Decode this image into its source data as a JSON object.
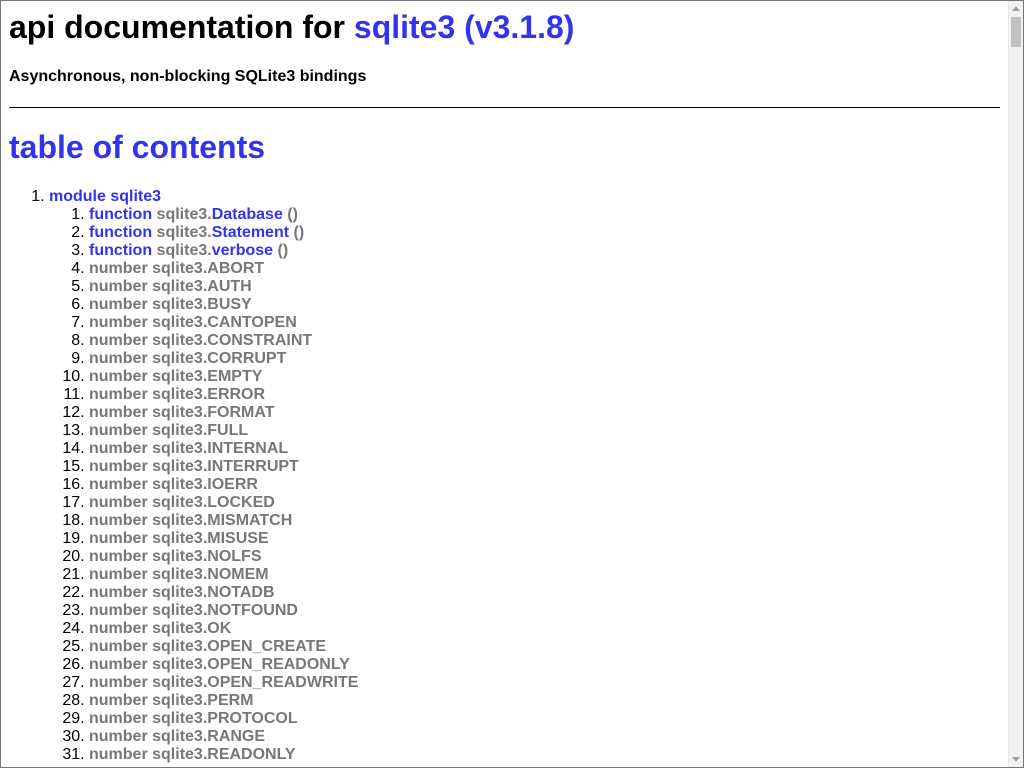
{
  "header": {
    "title_prefix": "api documentation for",
    "title_module": "sqlite3 (v3.1.8)",
    "subtitle": "Asynchronous, non-blocking SQLite3 bindings"
  },
  "toc": {
    "heading": "table of contents",
    "module": "module sqlite3",
    "items": [
      {
        "kind": "function",
        "ns": "sqlite3.",
        "name": "Database",
        "suffix": " ()"
      },
      {
        "kind": "function",
        "ns": "sqlite3.",
        "name": "Statement",
        "suffix": " ()"
      },
      {
        "kind": "function",
        "ns": "sqlite3.",
        "name": "verbose",
        "suffix": " ()"
      },
      {
        "kind": "number",
        "ns": "sqlite3.",
        "name": "ABORT",
        "suffix": ""
      },
      {
        "kind": "number",
        "ns": "sqlite3.",
        "name": "AUTH",
        "suffix": ""
      },
      {
        "kind": "number",
        "ns": "sqlite3.",
        "name": "BUSY",
        "suffix": ""
      },
      {
        "kind": "number",
        "ns": "sqlite3.",
        "name": "CANTOPEN",
        "suffix": ""
      },
      {
        "kind": "number",
        "ns": "sqlite3.",
        "name": "CONSTRAINT",
        "suffix": ""
      },
      {
        "kind": "number",
        "ns": "sqlite3.",
        "name": "CORRUPT",
        "suffix": ""
      },
      {
        "kind": "number",
        "ns": "sqlite3.",
        "name": "EMPTY",
        "suffix": ""
      },
      {
        "kind": "number",
        "ns": "sqlite3.",
        "name": "ERROR",
        "suffix": ""
      },
      {
        "kind": "number",
        "ns": "sqlite3.",
        "name": "FORMAT",
        "suffix": ""
      },
      {
        "kind": "number",
        "ns": "sqlite3.",
        "name": "FULL",
        "suffix": ""
      },
      {
        "kind": "number",
        "ns": "sqlite3.",
        "name": "INTERNAL",
        "suffix": ""
      },
      {
        "kind": "number",
        "ns": "sqlite3.",
        "name": "INTERRUPT",
        "suffix": ""
      },
      {
        "kind": "number",
        "ns": "sqlite3.",
        "name": "IOERR",
        "suffix": ""
      },
      {
        "kind": "number",
        "ns": "sqlite3.",
        "name": "LOCKED",
        "suffix": ""
      },
      {
        "kind": "number",
        "ns": "sqlite3.",
        "name": "MISMATCH",
        "suffix": ""
      },
      {
        "kind": "number",
        "ns": "sqlite3.",
        "name": "MISUSE",
        "suffix": ""
      },
      {
        "kind": "number",
        "ns": "sqlite3.",
        "name": "NOLFS",
        "suffix": ""
      },
      {
        "kind": "number",
        "ns": "sqlite3.",
        "name": "NOMEM",
        "suffix": ""
      },
      {
        "kind": "number",
        "ns": "sqlite3.",
        "name": "NOTADB",
        "suffix": ""
      },
      {
        "kind": "number",
        "ns": "sqlite3.",
        "name": "NOTFOUND",
        "suffix": ""
      },
      {
        "kind": "number",
        "ns": "sqlite3.",
        "name": "OK",
        "suffix": ""
      },
      {
        "kind": "number",
        "ns": "sqlite3.",
        "name": "OPEN_CREATE",
        "suffix": ""
      },
      {
        "kind": "number",
        "ns": "sqlite3.",
        "name": "OPEN_READONLY",
        "suffix": ""
      },
      {
        "kind": "number",
        "ns": "sqlite3.",
        "name": "OPEN_READWRITE",
        "suffix": ""
      },
      {
        "kind": "number",
        "ns": "sqlite3.",
        "name": "PERM",
        "suffix": ""
      },
      {
        "kind": "number",
        "ns": "sqlite3.",
        "name": "PROTOCOL",
        "suffix": ""
      },
      {
        "kind": "number",
        "ns": "sqlite3.",
        "name": "RANGE",
        "suffix": ""
      },
      {
        "kind": "number",
        "ns": "sqlite3.",
        "name": "READONLY",
        "suffix": ""
      }
    ]
  },
  "colors": {
    "link": "#3333ee",
    "muted": "#777777",
    "text": "#000000"
  }
}
